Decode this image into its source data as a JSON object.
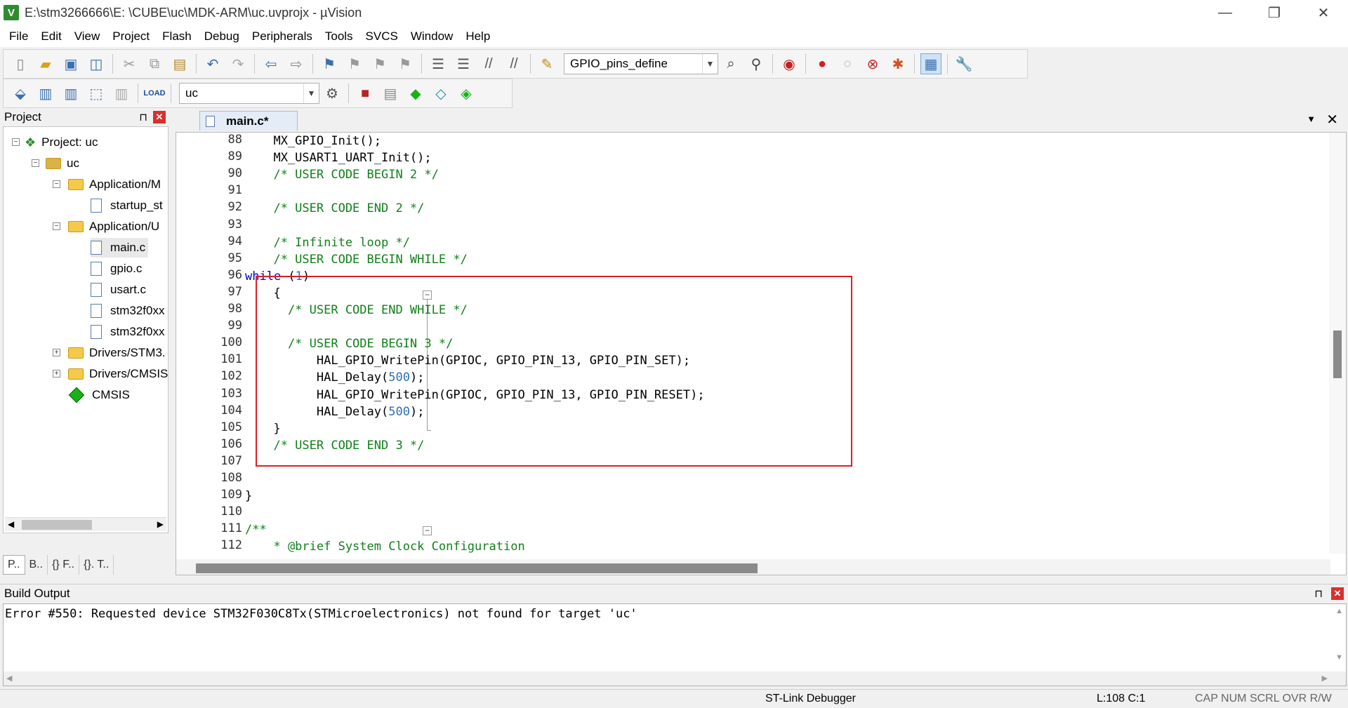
{
  "window": {
    "title": "E:\\stm3266666\\E:  \\CUBE\\uc\\MDK-ARM\\uc.uvprojx - µVision",
    "minimize": "—",
    "restore": "❐",
    "close": "✕"
  },
  "menu": [
    "File",
    "Edit",
    "View",
    "Project",
    "Flash",
    "Debug",
    "Peripherals",
    "Tools",
    "SVCS",
    "Window",
    "Help"
  ],
  "toolbar": {
    "find_combo": "GPIO_pins_define",
    "target_combo": "uc"
  },
  "project_panel": {
    "title": "Project",
    "pin": "⊓",
    "close": "✕",
    "tree": [
      {
        "label": "Project: uc"
      },
      {
        "label": "uc"
      },
      {
        "label": "Application/M"
      },
      {
        "label": "startup_st"
      },
      {
        "label": "Application/U"
      },
      {
        "label": "main.c"
      },
      {
        "label": "gpio.c"
      },
      {
        "label": "usart.c"
      },
      {
        "label": "stm32f0xx"
      },
      {
        "label": "stm32f0xx"
      },
      {
        "label": "Drivers/STM3."
      },
      {
        "label": "Drivers/CMSIS"
      },
      {
        "label": "CMSIS"
      }
    ],
    "bottom_tabs": [
      "P..",
      "B..",
      "{} F..",
      "{}. T.."
    ]
  },
  "editor": {
    "tab": "main.c*",
    "lines": [
      {
        "n": "88",
        "parts": [
          {
            "t": "  MX_GPIO_Init();",
            "c": "tx"
          }
        ]
      },
      {
        "n": "89",
        "parts": [
          {
            "t": "  MX_USART1_UART_Init();",
            "c": "tx"
          }
        ]
      },
      {
        "n": "90",
        "parts": [
          {
            "t": "  /* USER CODE BEGIN 2 */",
            "c": "cm"
          }
        ]
      },
      {
        "n": "91",
        "parts": []
      },
      {
        "n": "92",
        "parts": [
          {
            "t": "  /* USER CODE END 2 */",
            "c": "cm"
          }
        ]
      },
      {
        "n": "93",
        "parts": []
      },
      {
        "n": "94",
        "parts": [
          {
            "t": "  /* Infinite loop */",
            "c": "cm"
          }
        ]
      },
      {
        "n": "95",
        "parts": [
          {
            "t": "  /* USER CODE BEGIN WHILE */",
            "c": "cm"
          }
        ]
      },
      {
        "n": "96",
        "parts": [
          {
            "t": "while",
            "c": "kw"
          },
          {
            "t": " (",
            "c": "tx"
          },
          {
            "t": "1",
            "c": "num"
          },
          {
            "t": ")",
            "c": "tx"
          }
        ]
      },
      {
        "n": "97",
        "parts": [
          {
            "t": "  {",
            "c": "tx"
          }
        ]
      },
      {
        "n": "98",
        "parts": [
          {
            "t": "    /* USER CODE END WHILE */",
            "c": "cm"
          }
        ]
      },
      {
        "n": "99",
        "parts": []
      },
      {
        "n": "100",
        "parts": [
          {
            "t": "    /* USER CODE BEGIN 3 */",
            "c": "cm"
          }
        ]
      },
      {
        "n": "101",
        "parts": [
          {
            "t": "        HAL_GPIO_WritePin(GPIOC, GPIO_PIN_13, GPIO_PIN_SET);",
            "c": "tx"
          }
        ]
      },
      {
        "n": "102",
        "parts": [
          {
            "t": "        HAL_Delay(",
            "c": "tx"
          },
          {
            "t": "500",
            "c": "num"
          },
          {
            "t": ");",
            "c": "tx"
          }
        ]
      },
      {
        "n": "103",
        "parts": [
          {
            "t": "        HAL_GPIO_WritePin(GPIOC, GPIO_PIN_13, GPIO_PIN_RESET);",
            "c": "tx"
          }
        ]
      },
      {
        "n": "104",
        "parts": [
          {
            "t": "        HAL_Delay(",
            "c": "tx"
          },
          {
            "t": "500",
            "c": "num"
          },
          {
            "t": ");",
            "c": "tx"
          }
        ]
      },
      {
        "n": "105",
        "parts": [
          {
            "t": "  }",
            "c": "tx"
          }
        ]
      },
      {
        "n": "106",
        "parts": [
          {
            "t": "  /* USER CODE END 3 */",
            "c": "cm"
          }
        ]
      },
      {
        "n": "107",
        "parts": []
      },
      {
        "n": "108",
        "parts": []
      },
      {
        "n": "109",
        "parts": [
          {
            "t": "}",
            "c": "tx"
          }
        ]
      },
      {
        "n": "110",
        "parts": []
      },
      {
        "n": "111",
        "parts": [
          {
            "t": "/**",
            "c": "cm"
          }
        ]
      },
      {
        "n": "112",
        "parts": [
          {
            "t": "  * @brief System Clock Configuration",
            "c": "cm"
          }
        ]
      }
    ]
  },
  "build_output": {
    "title": "Build Output",
    "message": "Error #550: Requested device STM32F030C8Tx(STMicroelectronics) not found for target 'uc'"
  },
  "status": {
    "debugger": "ST-Link Debugger",
    "position": "L:108 C:1",
    "flags": "CAP  NUM  SCRL  OVR  R/W"
  }
}
